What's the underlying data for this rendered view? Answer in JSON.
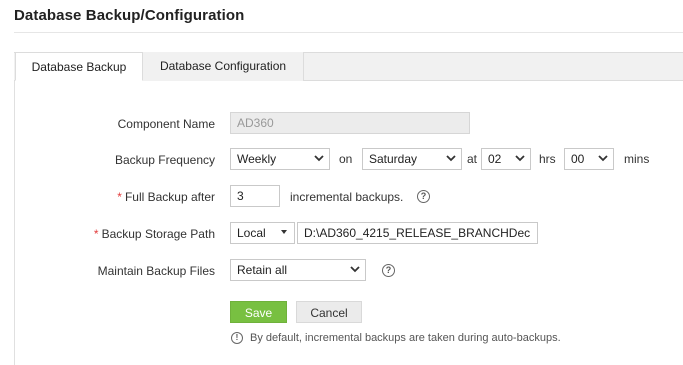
{
  "page": {
    "title": "Database Backup/Configuration"
  },
  "tabs": [
    {
      "label": "Database Backup",
      "active": true
    },
    {
      "label": "Database Configuration",
      "active": false
    }
  ],
  "form": {
    "component_name": {
      "label": "Component Name",
      "value": "AD360"
    },
    "backup_frequency": {
      "label": "Backup Frequency",
      "frequency": "Weekly",
      "on_label": "on",
      "day": "Saturday",
      "at_label": "at",
      "hour": "02",
      "hrs_label": "hrs",
      "minute": "00",
      "mins_label": "mins"
    },
    "full_backup": {
      "required_mark": "*",
      "label": "Full Backup after",
      "value": "3",
      "suffix": "incremental backups."
    },
    "storage_path": {
      "required_mark": "*",
      "label": "Backup Storage Path",
      "location": "Local",
      "path": "D:\\AD360_4215_RELEASE_BRANCHDec"
    },
    "maintain_files": {
      "label": "Maintain Backup Files",
      "value": "Retain all"
    }
  },
  "buttons": {
    "save": "Save",
    "cancel": "Cancel"
  },
  "note": {
    "icon": "info-icon",
    "text": "By default, incremental backups are taken during auto-backups."
  },
  "colors": {
    "save_button": "#78c041",
    "required": "#e23b3b",
    "tab_bar": "#f1f1f1"
  }
}
